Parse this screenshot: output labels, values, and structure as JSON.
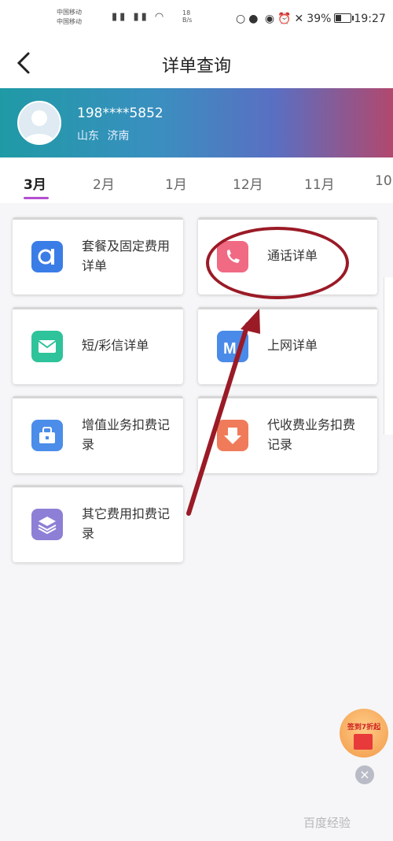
{
  "status_bar": {
    "carrier_1": "中国移动",
    "carrier_2": "中国移动",
    "net_speed_value": "18",
    "net_speed_unit": "B/s",
    "battery": "39%",
    "time": "19:27"
  },
  "header": {
    "title": "详单查询"
  },
  "user": {
    "phone": "198****5852",
    "location": "山东 济南"
  },
  "tabs": [
    {
      "label": "3月",
      "active": true
    },
    {
      "label": "2月"
    },
    {
      "label": "1月"
    },
    {
      "label": "12月"
    },
    {
      "label": "11月"
    },
    {
      "label": "10"
    }
  ],
  "cards": [
    {
      "label": "套餐及固定费用详单",
      "icon": "package-icon",
      "color": "#3b7de6"
    },
    {
      "label": "通话详单",
      "icon": "phone-call-icon",
      "color": "#f06a84"
    },
    {
      "label": "短/彩信详单",
      "icon": "message-icon",
      "color": "#2ec39a"
    },
    {
      "label": "上网详单",
      "icon": "internet-icon",
      "color": "#4a8ae8"
    },
    {
      "label": "增值业务扣费记录",
      "icon": "value-added-icon",
      "color": "#4b8de8"
    },
    {
      "label": "代收费业务扣费记录",
      "icon": "collection-fee-icon",
      "color": "#f07b5a"
    },
    {
      "label": "其它费用扣费记录",
      "icon": "layers-icon",
      "color": "#8d7fd6"
    }
  ],
  "annotation_color": "#9a1a26",
  "promo": {
    "text": "签到7折起"
  },
  "watermark": "百度经验"
}
